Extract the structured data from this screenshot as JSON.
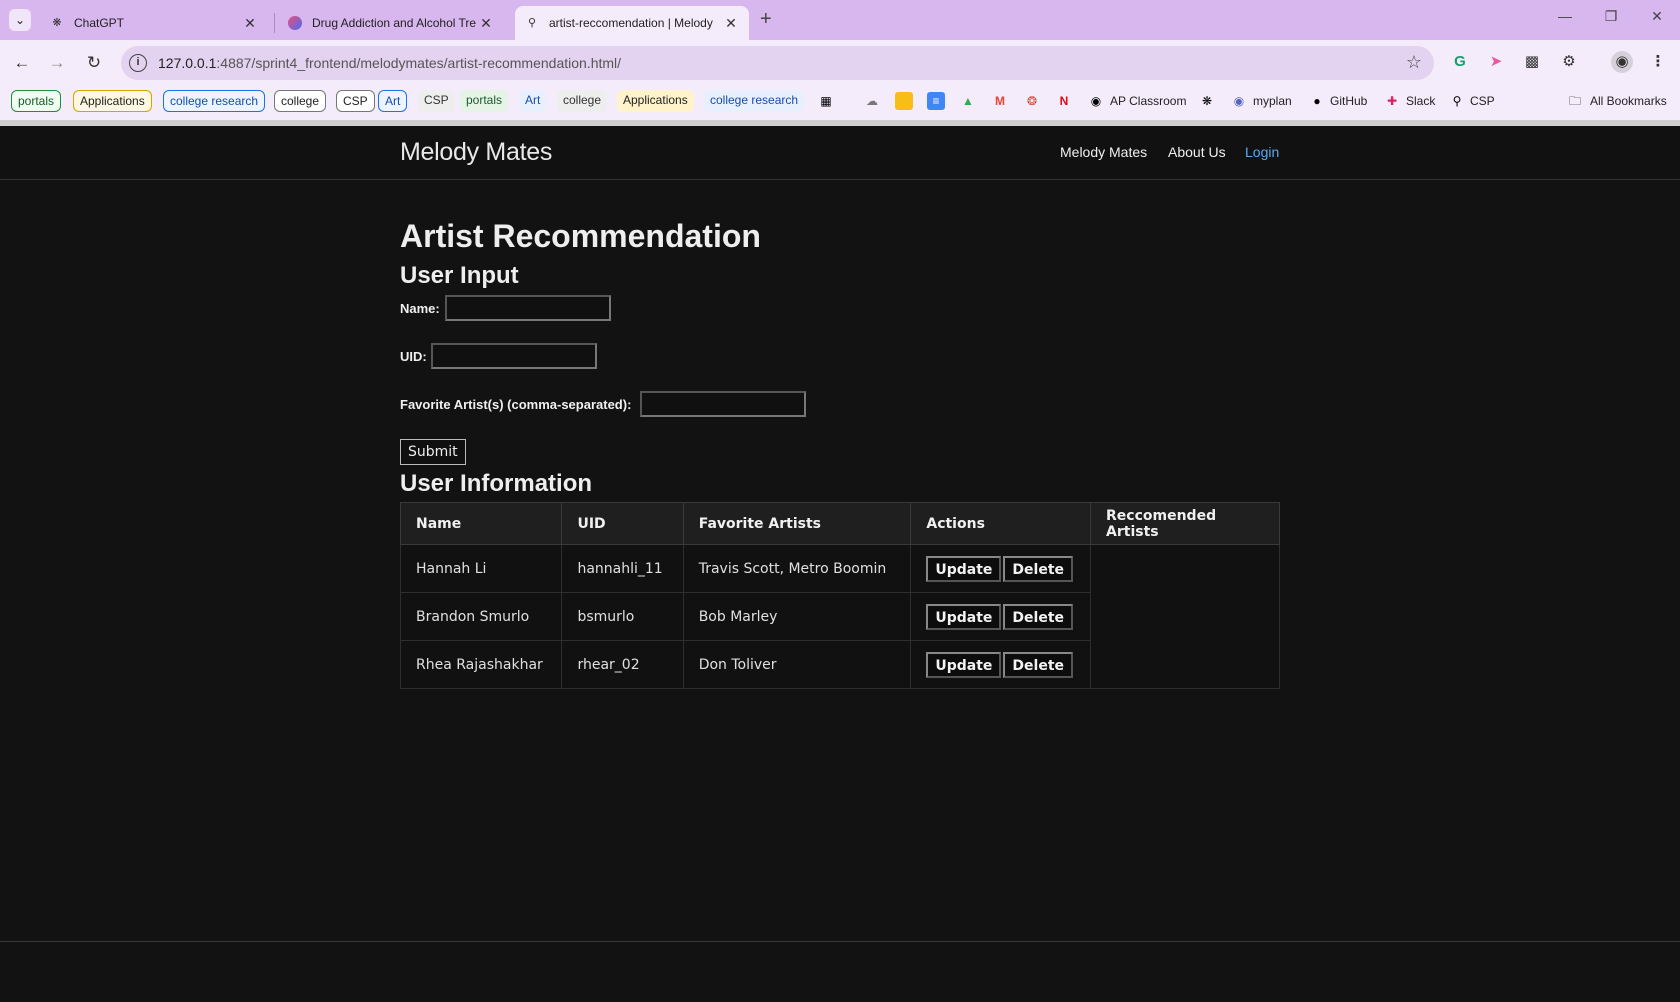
{
  "browser": {
    "tabs": [
      {
        "title": "ChatGPT",
        "icon": "chatgpt-icon"
      },
      {
        "title": "Drug Addiction and Alcohol Tre",
        "icon": "gradient-logo-icon"
      },
      {
        "title": "artist-reccomendation | Melody",
        "icon": "magnifier-favicon-icon"
      }
    ],
    "url_host": "127.0.0.1",
    "url_rest": ":4887/sprint4_frontend/melodymates/artist-recommendation.html/",
    "bookmarks": {
      "chip1": "portals",
      "chip2": "Applications",
      "chip3": "college research",
      "chip4": "college",
      "chip5": "CSP",
      "chip6": "Art",
      "plain1": "CSP",
      "plain2": "portals",
      "plain3": "Art",
      "plain4": "college",
      "plain5": "Applications",
      "plain6": "college research",
      "ap": "AP Classroom",
      "myplan": "myplan",
      "github": "GitHub",
      "slack": "Slack",
      "csp": "CSP",
      "all": "All Bookmarks"
    }
  },
  "site": {
    "brand": "Melody Mates",
    "nav": {
      "home": "Melody Mates",
      "about": "About Us",
      "login": "Login"
    },
    "colors": {
      "background": "#121212",
      "login_link": "#5aa9f0"
    }
  },
  "page": {
    "title": "Artist Recommendation",
    "input_heading": "User Input",
    "name_label": "Name:",
    "uid_label": "UID:",
    "artists_label": "Favorite Artist(s) (comma-separated):",
    "submit_label": "Submit",
    "info_heading": "User Information"
  },
  "table": {
    "headers": {
      "name": "Name",
      "uid": "UID",
      "artists": "Favorite Artists",
      "actions": "Actions",
      "recommended": "Reccomended Artists"
    },
    "update_label": "Update",
    "delete_label": "Delete",
    "rows": [
      {
        "name": "Hannah Li",
        "uid": "hannahli_11",
        "artists": "Travis Scott, Metro Boomin"
      },
      {
        "name": "Brandon Smurlo",
        "uid": "bsmurlo",
        "artists": "Bob Marley"
      },
      {
        "name": "Rhea Rajashakhar",
        "uid": "rhear_02",
        "artists": "Don Toliver"
      }
    ]
  }
}
